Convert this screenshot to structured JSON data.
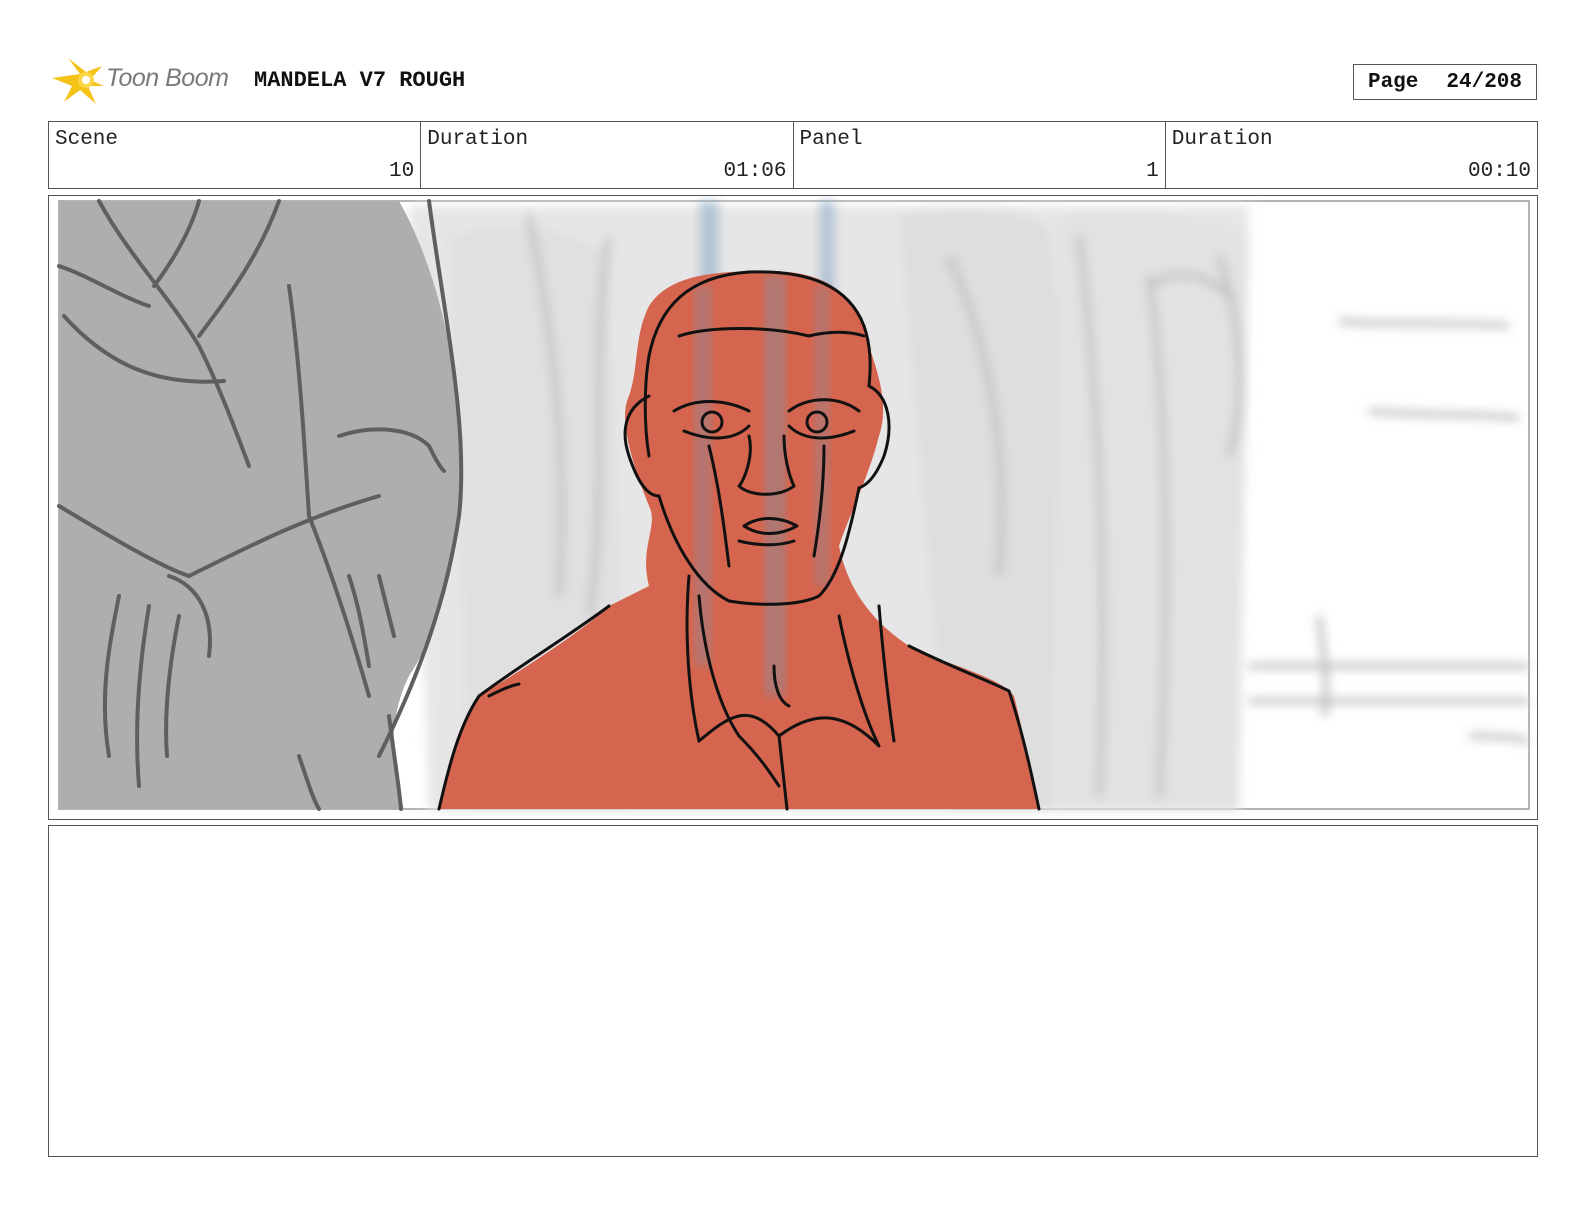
{
  "header": {
    "logo_text": "Toon Boom",
    "project_title": "MANDELA V7 ROUGH",
    "page_label": "Page",
    "page_number": "24/208"
  },
  "info": {
    "scene_label": "Scene",
    "scene_value": "10",
    "scene_duration_label": "Duration",
    "scene_duration_value": "01:06",
    "panel_label": "Panel",
    "panel_value": "1",
    "panel_duration_label": "Duration",
    "panel_duration_value": "00:10"
  },
  "colors": {
    "character_fill": "#d5654f",
    "foreground_figure": "#aeaeae",
    "background_sketch": "#dadada",
    "logo_accent": "#f5c218"
  },
  "icons": {
    "logo": "toon-boom-star-icon"
  }
}
